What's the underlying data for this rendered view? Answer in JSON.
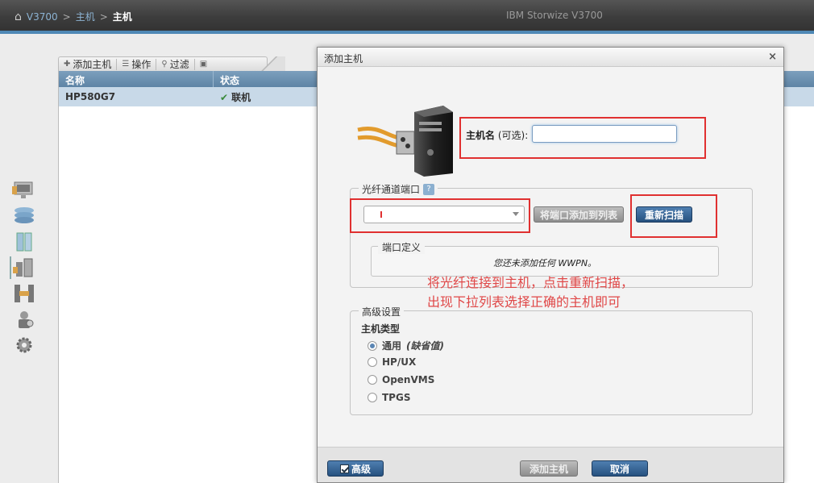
{
  "header": {
    "breadcrumb": [
      "V3700",
      "主机",
      "主机"
    ],
    "separator": ">",
    "product": "IBM Storwize V3700"
  },
  "leftnav": {
    "icons": [
      "monitor-icon",
      "storage-pool-icon",
      "volumes-icon",
      "hosts-icon",
      "copy-services-icon",
      "access-icon",
      "settings-icon"
    ],
    "active": "hosts-icon"
  },
  "toolbar": {
    "add_host": "添加主机",
    "actions": "操作",
    "filter": "过滤"
  },
  "table": {
    "columns": [
      "名称",
      "状态"
    ],
    "rows": [
      {
        "name": "HP580G7",
        "status": "联机",
        "status_color": "#3a8a3a"
      }
    ]
  },
  "dialog": {
    "title": "添加主机",
    "close": "×",
    "hostname": {
      "label": "主机名",
      "optional": "(可选):",
      "value": ""
    },
    "fc_ports": {
      "legend": "光纤通道端口",
      "help": "?",
      "combo_value": "",
      "add_button": "将端口添加到列表",
      "rescan_button": "重新扫描",
      "port_definition": {
        "legend": "端口定义",
        "empty_text": "您还未添加任何 WWPN。"
      }
    },
    "annotation": {
      "line1": "将光纤连接到主机，点击重新扫描，",
      "line2": "出现下拉列表选择正确的主机即可",
      "color": "#e04848"
    },
    "advanced": {
      "legend": "高级设置",
      "host_type_label": "主机类型",
      "options": [
        {
          "label": "通用",
          "suffix": "(缺省值)",
          "selected": true
        },
        {
          "label": "HP/UX",
          "suffix": "",
          "selected": false
        },
        {
          "label": "OpenVMS",
          "suffix": "",
          "selected": false
        },
        {
          "label": "TPGS",
          "suffix": "",
          "selected": false
        }
      ]
    },
    "footer": {
      "advanced_toggle": "高级",
      "add_button": "添加主机",
      "cancel_button": "取消"
    }
  },
  "colors": {
    "accent": "#4e88b5",
    "highlight_box": "#e03030",
    "primary_button": "#26517f"
  }
}
